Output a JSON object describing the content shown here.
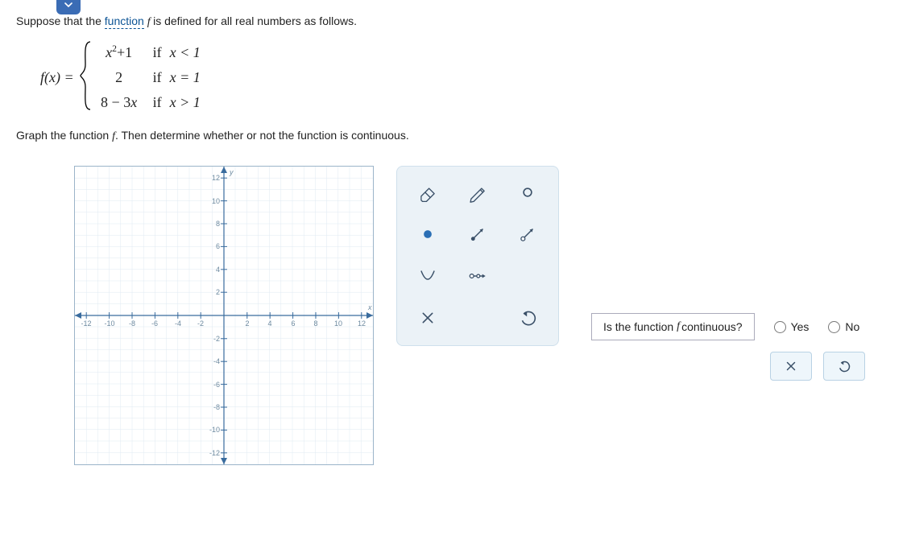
{
  "intro_prefix": "Suppose that the ",
  "intro_link": "function",
  "intro_suffix": " is defined for all real numbers as follows.",
  "function_name": "f",
  "lhs": "f(x) =",
  "cases": [
    {
      "expr_html": "x<span class='sup'>2</span>+1",
      "if": "if",
      "cond": "x < 1"
    },
    {
      "expr_html": "2",
      "if": "if",
      "cond": "x = 1"
    },
    {
      "expr_html": "8 − 3x",
      "if": "if",
      "cond": "x > 1"
    }
  ],
  "instruction_pre": "Graph the function ",
  "instruction_mid": ". Then determine whether or not the function is continuous.",
  "question": "Is the function",
  "question_suffix": " continuous?",
  "yes": "Yes",
  "no": "No",
  "axis_y": "y",
  "axis_x": "x",
  "ticks": [
    "-12",
    "-10",
    "-8",
    "-6",
    "-4",
    "-2",
    "2",
    "4",
    "6",
    "8",
    "10",
    "12"
  ],
  "yticks": [
    "12",
    "10",
    "8",
    "6",
    "4",
    "2",
    "-2",
    "-4",
    "-6",
    "-8",
    "-10",
    "-12"
  ],
  "chart_data": {
    "type": "line",
    "title": "",
    "xlabel": "x",
    "ylabel": "y",
    "xlim": [
      -13,
      13
    ],
    "ylim": [
      -13,
      13
    ],
    "grid": true,
    "series": []
  },
  "tools": {
    "eraser": "eraser-tool",
    "pencil": "pencil-tool",
    "open_point": "open-point-tool",
    "closed_point": "closed-point-tool",
    "ray_closed": "ray-closed-tool",
    "ray_open": "ray-open-tool",
    "parabola": "parabola-tool",
    "segment": "open-segment-tool",
    "clear": "clear-tool",
    "undo": "undo-tool"
  }
}
